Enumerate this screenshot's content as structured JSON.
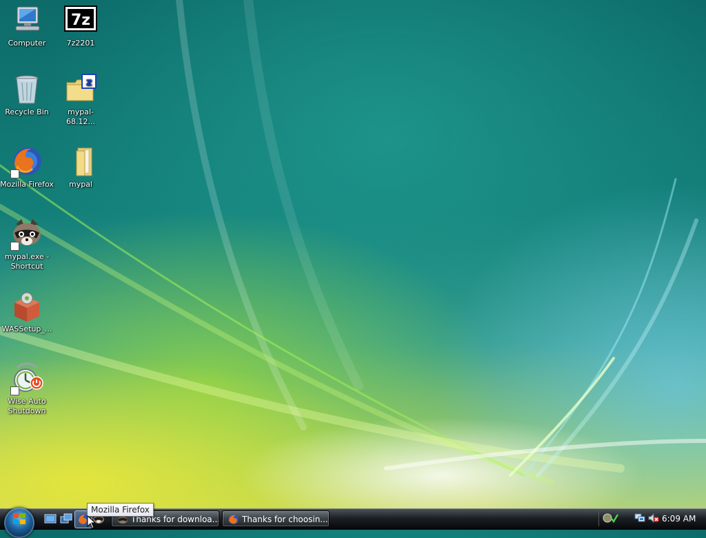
{
  "desktop": {
    "icons": [
      {
        "label": "Computer",
        "icon": "computer-icon"
      },
      {
        "label": "7z2201",
        "icon": "7zip-icon"
      },
      {
        "label": "Recycle Bin",
        "icon": "recycle-bin-icon"
      },
      {
        "label": "mypal-68.12...",
        "icon": "zip-folder-icon"
      },
      {
        "label": "Mozilla Firefox",
        "icon": "firefox-icon"
      },
      {
        "label": "mypal",
        "icon": "folder-icon"
      },
      {
        "label": "mypal.exe - Shortcut",
        "icon": "raccoon-icon"
      },
      {
        "label": "WASSetup_...",
        "icon": "installer-box-icon"
      },
      {
        "label": "Wise Auto Shutdown",
        "icon": "alarm-clock-icon"
      }
    ]
  },
  "taskbar": {
    "quick_launch": [
      "show-desktop-icon",
      "switch-windows-icon",
      "firefox-icon",
      "mypal-icon"
    ],
    "buttons": [
      {
        "label": "Thanks for downloa...",
        "icon": "mypal-icon"
      },
      {
        "label": "Thanks for choosin...",
        "icon": "firefox-icon"
      }
    ],
    "tray_icons": [
      "update-icon",
      "network-icon",
      "volume-muted-icon"
    ],
    "clock": "6:09 AM"
  },
  "tooltip": {
    "text": "Mozilla Firefox"
  },
  "colors": {
    "taskbar": "#1b1f24",
    "desktop_accent": "#137e78"
  }
}
